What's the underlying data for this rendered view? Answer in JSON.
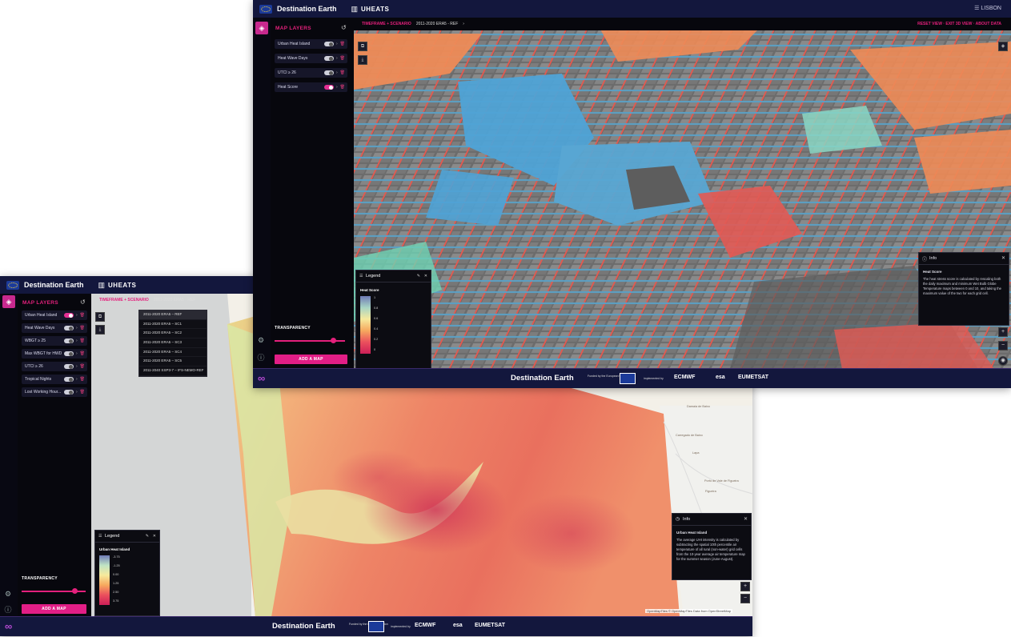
{
  "app": {
    "brand": "Destination Earth",
    "app_name": "UHEATS",
    "menu_label": "☰ LISBON"
  },
  "icons": [
    "eu-flag-icon",
    "building-icon",
    "layers-icon",
    "history-icon",
    "chevron-right-icon",
    "trash-icon",
    "settings-icon",
    "info-icon",
    "copy-icon",
    "download-icon",
    "pencil-icon",
    "close-icon",
    "plus-icon",
    "minus-icon",
    "compass-icon"
  ],
  "colors": {
    "accent": "#e4207c",
    "topbar": "#13173d",
    "panel": "#07070d"
  },
  "window_a": {
    "panel_title": "MAP LAYERS",
    "layers": [
      {
        "label": "Urban Heat Island",
        "on": true
      },
      {
        "label": "Heat Wave Days",
        "on": false
      },
      {
        "label": "WBGT ≥ 25",
        "on": false
      },
      {
        "label": "Max WBGT for HWD",
        "on": false
      },
      {
        "label": "UTCI ≥ 26",
        "on": false
      },
      {
        "label": "Tropical Nights",
        "on": false
      },
      {
        "label": "Lost Working Hour...",
        "on": false
      }
    ],
    "transparency_label": "TRANSPARENCY",
    "transparency": 0.85,
    "add_map_label": "ADD A MAP",
    "crumb_pink": "TIMEFRAME + SCENARIO",
    "crumb_current": "2011-2020 ERA5 - REF",
    "dropdown_options": [
      "2011-2020 ERA5 – REF",
      "2011-2020 ERA5 – SC1",
      "2011-2020 ERA5 – SC2",
      "2011-2020 ERA5 – SC3",
      "2011-2020 ERA5 – SC4",
      "2011-2020 ERA5 – SC5",
      "2011-2040 SSP3-7 – IFS-NEMO-REF"
    ],
    "legend": {
      "title": "Legend",
      "subtitle": "Urban Heat Island",
      "ticks": [
        "-3.75",
        "-1.25",
        "0.00",
        "1.25",
        "2.50",
        "3.75"
      ]
    },
    "info": {
      "title": "Info",
      "subtitle": "Urban Heat Island",
      "body": "The average UHI intensity is calculated by subtracting the spatial 10th percentile air temperature of all rural (non-water) grid cells from the 10-year average air temperature map for the summer season (June-August)."
    },
    "attribution": "OpenMapTiles © OpenMapTiles Data from OpenStreetMap",
    "places": [
      "Damaia de Baixo",
      "Carregado de Baixo",
      "Lapa",
      "Porto de Vale de Figueira",
      "Figueira"
    ]
  },
  "window_b": {
    "panel_title": "MAP LAYERS",
    "layers": [
      {
        "label": "Urban Heat Island",
        "on": false
      },
      {
        "label": "Heat Wave Days",
        "on": false
      },
      {
        "label": "UTCI ≥ 26",
        "on": false
      },
      {
        "label": "Heat Score",
        "on": true
      }
    ],
    "transparency_label": "TRANSPARENCY",
    "transparency": 0.9,
    "add_map_label": "ADD A MAP",
    "crumb_pink": "TIMEFRAME + SCENARIO",
    "crumb_current": "2011-2020 ERA5 - REF",
    "top_right_label": "RESET VIEW · EXIT 3D VIEW · ABOUT DATA",
    "legend": {
      "title": "Legend",
      "subtitle": "Heat Score",
      "ticks": [
        "1",
        "0.8",
        "0.6",
        "0.4",
        "0.2",
        "0"
      ]
    },
    "info": {
      "title": "Info",
      "subtitle": "Heat Score",
      "body": "The heat stress score is calculated by rescaling both the daily maximum and minimum Wet Bulb Globe Temperature maps between 0 and 10, and taking the maximum value of the two for each grid cell."
    }
  },
  "footer": {
    "brand": "Destination Earth",
    "funded_by": "Funded by the European Union",
    "implemented_by": "implemented by",
    "orgs": [
      "ECMWF",
      "esa",
      "EUMETSAT"
    ]
  }
}
